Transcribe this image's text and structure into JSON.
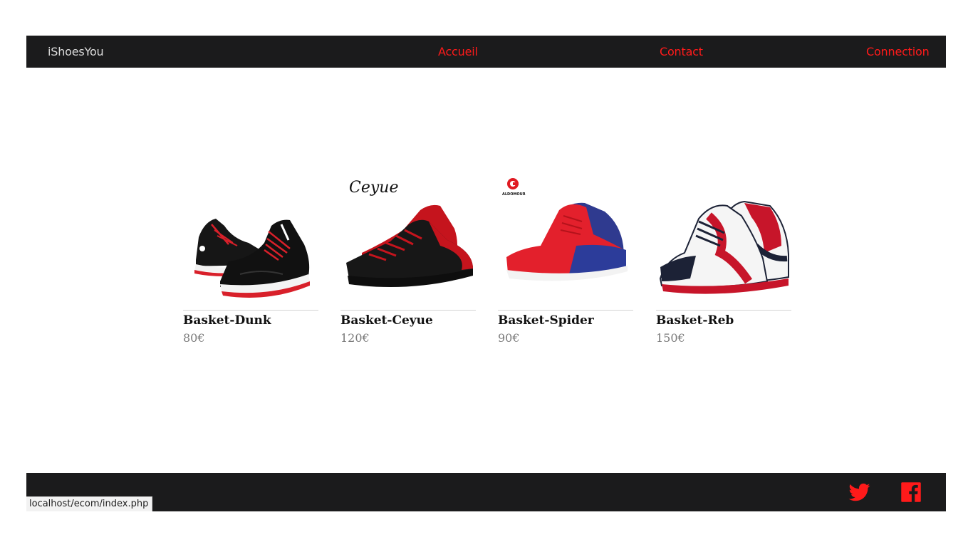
{
  "navbar": {
    "brand": "iShoesYou",
    "links": [
      {
        "label": "Accueil"
      },
      {
        "label": "Contact"
      },
      {
        "label": "Connection"
      }
    ]
  },
  "products": [
    {
      "name": "Basket-Dunk",
      "price": "80€"
    },
    {
      "name": "Basket-Ceyue",
      "price": "120€",
      "brand_logo": "Ceyue"
    },
    {
      "name": "Basket-Spider",
      "price": "90€",
      "brand_logo": "ALDOMOUR"
    },
    {
      "name": "Basket-Reb",
      "price": "150€"
    }
  ],
  "footer": {
    "icons": [
      "twitter-icon",
      "facebook-icon"
    ]
  },
  "status_bar": {
    "url": "localhost/ecom/index.php"
  },
  "colors": {
    "nav_bg": "#1b1b1c",
    "accent_red": "#ff1a1a",
    "brand_text": "#dcdcdc",
    "price_grey": "#7a7a7a"
  }
}
